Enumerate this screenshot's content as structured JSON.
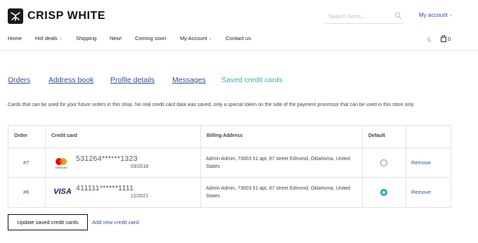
{
  "brand": {
    "name": "CRISP WHITE"
  },
  "search": {
    "placeholder": "Search items..."
  },
  "account": {
    "label": "My account",
    "chevron": "⌄"
  },
  "nav": [
    {
      "label": "Home",
      "has_dropdown": false
    },
    {
      "label": "Hot deals",
      "has_dropdown": true
    },
    {
      "label": "Shipping",
      "has_dropdown": false
    },
    {
      "label": "New!",
      "has_dropdown": false
    },
    {
      "label": "Coming soon",
      "has_dropdown": false
    },
    {
      "label": "My Account",
      "has_dropdown": true
    },
    {
      "label": "Contact us",
      "has_dropdown": false
    }
  ],
  "cart": {
    "count": "0"
  },
  "tabs": [
    {
      "label": "Orders",
      "active": false
    },
    {
      "label": "Address book",
      "active": false
    },
    {
      "label": "Profile details",
      "active": false
    },
    {
      "label": "Messages",
      "active": false
    },
    {
      "label": "Saved credit cards",
      "active": true
    }
  ],
  "info_text": "Cards that can be used for your future orders in this shop. No real credit card data was saved, only a special token on the side of the payment processor that can be used in this store only.",
  "table": {
    "headers": {
      "order": "Order",
      "card": "Credit card",
      "address": "Billing Address",
      "default": "Default"
    },
    "rows": [
      {
        "order": "#7",
        "brand": "mastercard-icon",
        "brand_text": "mastercard",
        "number": "531264******1323",
        "expiry": "03/2018",
        "address": "Admin Admin, 73003 51 apt, 87 street Edmond, Oklahoma, United States",
        "default": false,
        "action": "Remove"
      },
      {
        "order": "#6",
        "brand": "visa-icon",
        "brand_text": "VISA",
        "number": "411111******1111",
        "expiry": "12/2021",
        "address": "Admin Admin, 73003 51 apt, 87 street Edmond, Oklahoma, United States",
        "default": true,
        "action": "Remove"
      }
    ]
  },
  "actions": {
    "update_label": "Update saved credit cards",
    "add_label": "Add new credit card"
  },
  "colors": {
    "link": "#2f4fa0",
    "active_tab": "#24b4c9",
    "radio_checked": "#22a7c6"
  }
}
